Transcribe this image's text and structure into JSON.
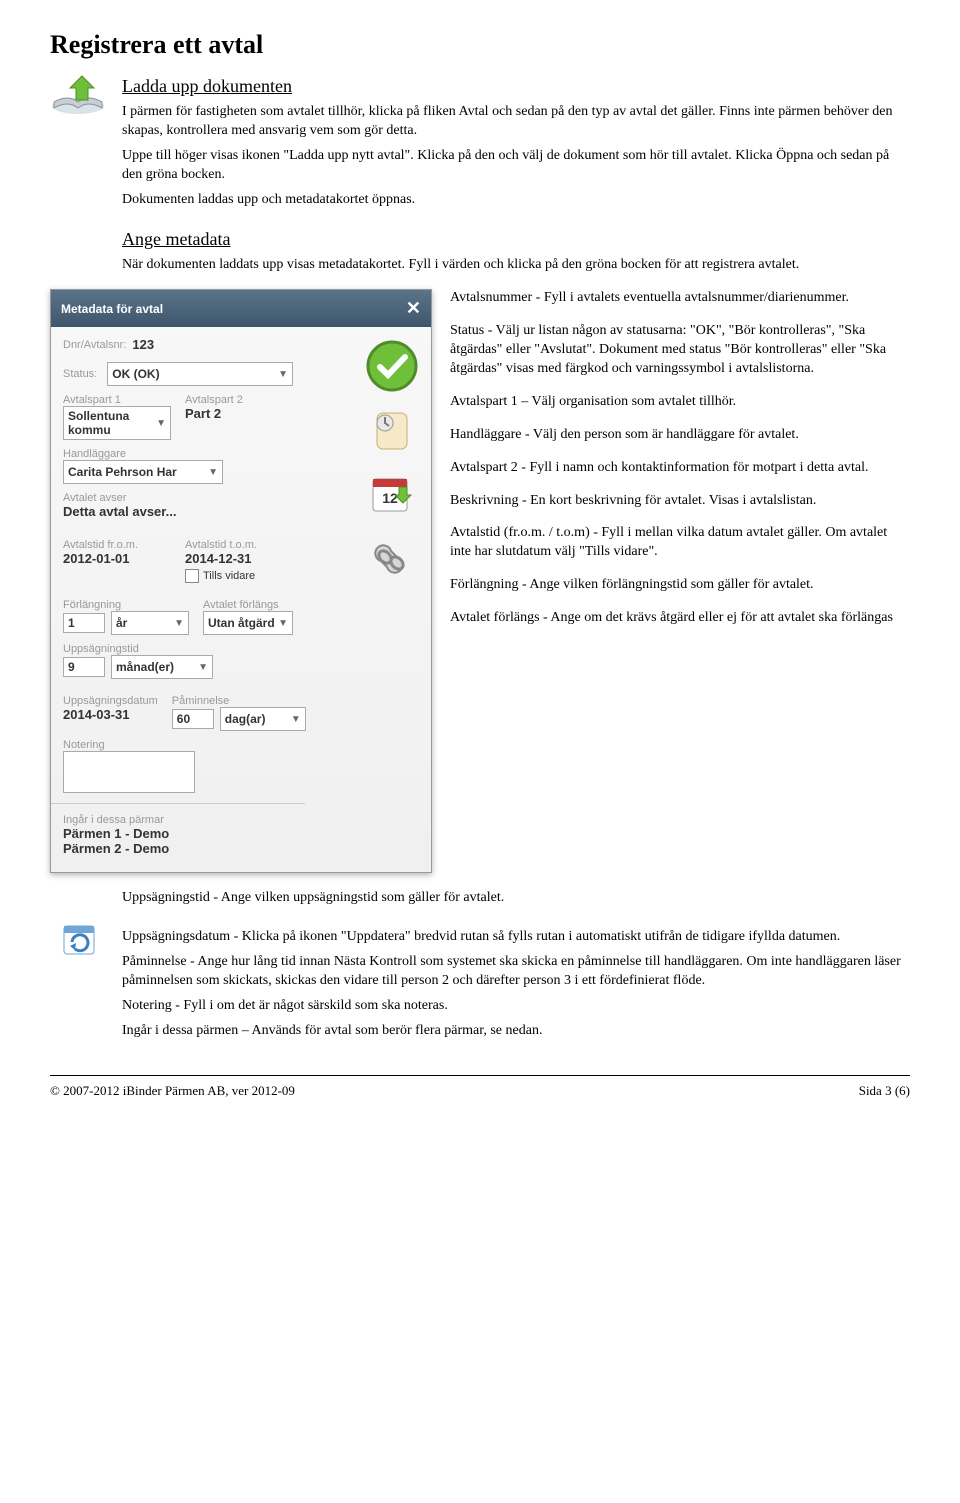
{
  "title": "Registrera ett avtal",
  "section1": {
    "heading": "Ladda upp dokumenten",
    "p1": "I pärmen för fastigheten som avtalet tillhör, klicka på fliken Avtal och sedan på den typ av avtal det gäller. Finns inte pärmen behöver den skapas, kontrollera med ansvarig vem som gör detta.",
    "p2": "Uppe till höger visas ikonen \"Ladda upp nytt avtal\". Klicka på den och välj de dokument som hör till avtalet. Klicka Öppna och sedan på den gröna bocken.",
    "p3": "Dokumenten laddas upp och metadatakortet öppnas."
  },
  "section2": {
    "heading": "Ange metadata",
    "intro": "När dokumenten laddats upp visas metadatakortet. Fyll i värden och klicka på den gröna bocken för att registrera avtalet."
  },
  "panel": {
    "title": "Metadata för avtal",
    "labels": {
      "dnr": "Dnr/Avtalsnr:",
      "status": "Status:",
      "part1": "Avtalspart 1",
      "part2": "Avtalspart 2",
      "handlaggare": "Handläggare",
      "avser": "Avtalet avser",
      "from": "Avtalstid fr.o.m.",
      "tom": "Avtalstid t.o.m.",
      "tills": "Tills vidare",
      "forlangning": "Förlängning",
      "forlangs": "Avtalet förlängs",
      "uppsagning": "Uppsägningstid",
      "uppsagdatum": "Uppsägningsdatum",
      "paminnelse": "Påminnelse",
      "notering": "Notering",
      "ingar": "Ingår i dessa pärmar"
    },
    "values": {
      "dnr": "123",
      "status": "OK (OK)",
      "part1": "Sollentuna kommu",
      "part2": "Part 2",
      "handlaggare": "Carita Pehrson Har",
      "avser": "Detta avtal avser...",
      "from": "2012-01-01",
      "tom": "2014-12-31",
      "forl_num": "1",
      "forl_unit": "år",
      "forlangs": "Utan åtgärd",
      "upps_num": "9",
      "upps_unit": "månad(er)",
      "uppsagdatum": "2014-03-31",
      "pam_num": "60",
      "pam_unit": "dag(ar)",
      "parm1": "Pärmen 1 - Demo",
      "parm2": "Pärmen 2 - Demo"
    }
  },
  "right": {
    "avtalsnummer": "Avtalsnummer - Fyll i avtalets eventuella avtalsnummer/diarienummer.",
    "status": "Status - Välj ur listan någon av statusarna: \"OK\", \"Bör kontrolleras\", \"Ska åtgärdas\" eller \"Avslutat\". Dokument med status \"Bör kontrolleras\" eller \"Ska åtgärdas\" visas med färgkod och varningssymbol i avtalslistorna.",
    "part1": "Avtalspart 1 – Välj organisation som avtalet tillhör.",
    "handlaggare": "Handläggare - Välj den person som är handläggare för avtalet.",
    "part2": "Avtalspart 2 - Fyll i namn och kontaktinformation för motpart i detta avtal.",
    "beskrivning": "Beskrivning - En kort beskrivning för avtalet. Visas i avtalslistan.",
    "avtalstid": "Avtalstid (fr.o.m. / t.o.m) - Fyll i mellan vilka datum avtalet gäller. Om avtalet inte har slutdatum välj \"Tills vidare\".",
    "forlangning": "Förlängning - Ange vilken förlängningstid som gäller för avtalet.",
    "forlangs": "Avtalet förlängs - Ange om det krävs åtgärd eller ej för att avtalet ska förlängas"
  },
  "below": {
    "uppsagningstid": "Uppsägningstid - Ange vilken uppsägningstid som gäller för avtalet.",
    "uppsagdatum": "Uppsägningsdatum - Klicka på ikonen \"Uppdatera\" bredvid rutan så fylls rutan i automatiskt utifrån de tidigare ifyllda datumen.",
    "paminnelse": "Påminnelse - Ange hur lång tid innan Nästa Kontroll som systemet ska skicka en påminnelse till handläggaren. Om inte handläggaren läser påminnelsen som skickats, skickas den vidare till person 2 och därefter person 3 i ett fördefinierat flöde.",
    "notering": "Notering - Fyll i om det är något särskild som ska noteras.",
    "ingar": "Ingår i dessa pärmen – Används för avtal som berör flera pärmar, se nedan."
  },
  "footer": {
    "left": "© 2007-2012 iBinder Pärmen AB, ver 2012-09",
    "right": "Sida 3 (6)"
  }
}
